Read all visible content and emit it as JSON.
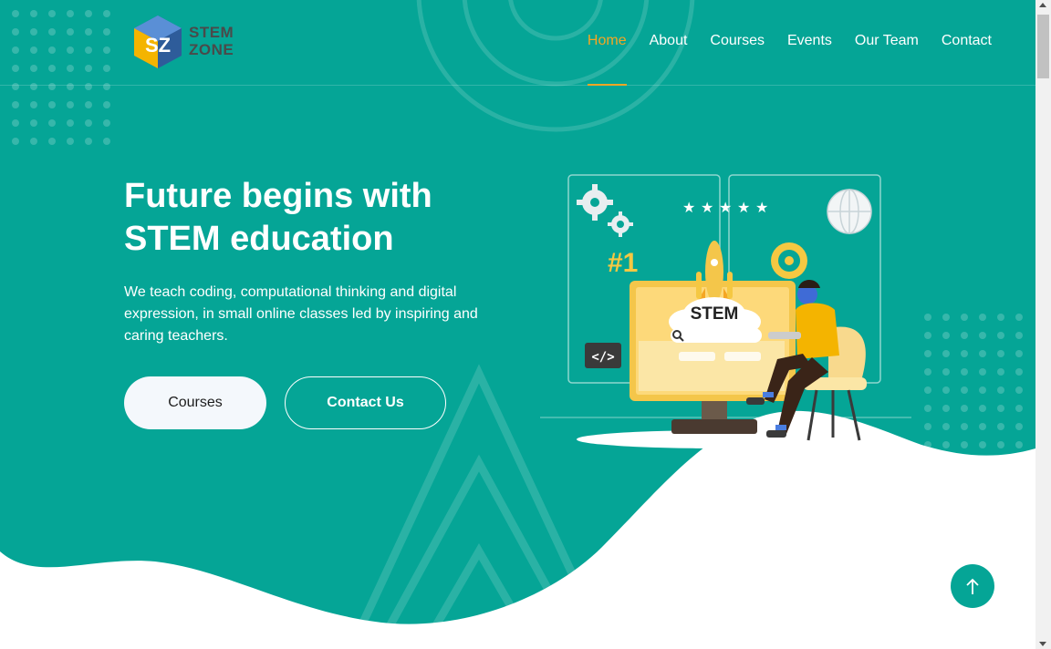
{
  "colors": {
    "primary": "#05a596",
    "accent": "#f5a623",
    "white": "#ffffff",
    "button_bg": "#f4f8fc"
  },
  "logo": {
    "line1": "STEM",
    "line2": "ZONE",
    "monogram": "SZ"
  },
  "nav": {
    "items": [
      {
        "label": "Home",
        "active": true
      },
      {
        "label": "About",
        "active": false
      },
      {
        "label": "Courses",
        "active": false
      },
      {
        "label": "Events",
        "active": false
      },
      {
        "label": "Our Team",
        "active": false
      },
      {
        "label": "Contact",
        "active": false
      }
    ]
  },
  "hero": {
    "title_line1": "Future begins with",
    "title_line2": "STEM education",
    "description": "We teach coding, computational thinking and digital expression, in small online classes led by inspiring and caring teachers.",
    "primary_button": "Courses",
    "secondary_button": "Contact Us"
  },
  "illustration": {
    "screen_label": "STEM",
    "rank_label": "#1",
    "code_label": "</>",
    "rating_stars": 5,
    "icons": [
      "gears-icon",
      "globe-icon",
      "rocket-icon",
      "search-icon",
      "code-icon"
    ]
  },
  "back_to_top": {
    "icon": "arrow-up-icon"
  }
}
